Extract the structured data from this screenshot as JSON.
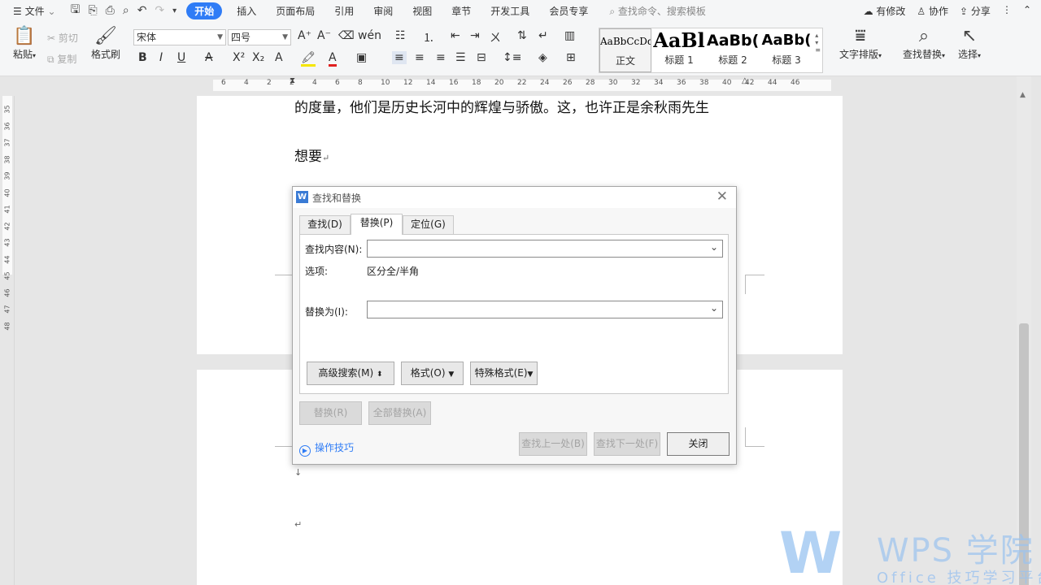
{
  "menubar": {
    "file_label": "文件",
    "tabs": [
      "开始",
      "插入",
      "页面布局",
      "引用",
      "审阅",
      "视图",
      "章节",
      "开发工具",
      "会员专享"
    ],
    "active_tab": "开始",
    "search_placeholder": "查找命令、搜索模板",
    "right": [
      "有修改",
      "协作",
      "分享"
    ]
  },
  "ribbon": {
    "paste": "粘贴",
    "cut": "剪切",
    "copy": "复制",
    "format_painter": "格式刷",
    "font_name": "宋体",
    "font_size": "四号",
    "styles": [
      {
        "preview": "AaBbCcDd",
        "caption": "正文"
      },
      {
        "preview": "AaBl",
        "caption": "标题 1"
      },
      {
        "preview": "AaBb(",
        "caption": "标题 2"
      },
      {
        "preview": "AaBb(",
        "caption": "标题 3"
      }
    ],
    "text_layout": "文字排版",
    "find_replace": "查找替换",
    "select": "选择"
  },
  "ruler": {
    "h_numbers": [
      "6",
      "4",
      "2",
      "2",
      "4",
      "6",
      "8",
      "10",
      "12",
      "14",
      "16",
      "18",
      "20",
      "22",
      "24",
      "26",
      "28",
      "30",
      "32",
      "34",
      "36",
      "38",
      "40",
      "42",
      "44",
      "46"
    ],
    "v_numbers": [
      "35",
      "36",
      "37",
      "38",
      "39",
      "40",
      "41",
      "42",
      "43",
      "44",
      "45",
      "46",
      "47",
      "48"
    ]
  },
  "document": {
    "line1": "的度量，他们是历史长河中的辉煌与骄傲。这，也许正是余秋雨先生",
    "line2": "想要",
    "para_mark": "↵",
    "para_mark2": "↓"
  },
  "dialog": {
    "title": "查找和替换",
    "tabs": [
      "查找(D)",
      "替换(P)",
      "定位(G)"
    ],
    "active_tab": "替换(P)",
    "find_label": "查找内容(N):",
    "find_value": "",
    "options_label": "选项:",
    "options_value": "区分全/半角",
    "replace_label": "替换为(I):",
    "replace_value": "",
    "advanced_search": "高级搜索(M)",
    "format": "格式(O)",
    "special": "特殊格式(E)",
    "replace_btn": "替换(R)",
    "replace_all_btn": "全部替换(A)",
    "tips": "操作技巧",
    "find_prev": "查找上一处(B)",
    "find_next": "查找下一处(F)",
    "close": "关闭"
  },
  "watermark": {
    "logo": "W",
    "brand": "WPS 学院",
    "sub": "Office 技巧学习平台"
  },
  "colors": {
    "accent": "#2f7cf6",
    "ribbon_bg": "#f5f6f7",
    "workspace_bg": "#e6e6e6"
  }
}
